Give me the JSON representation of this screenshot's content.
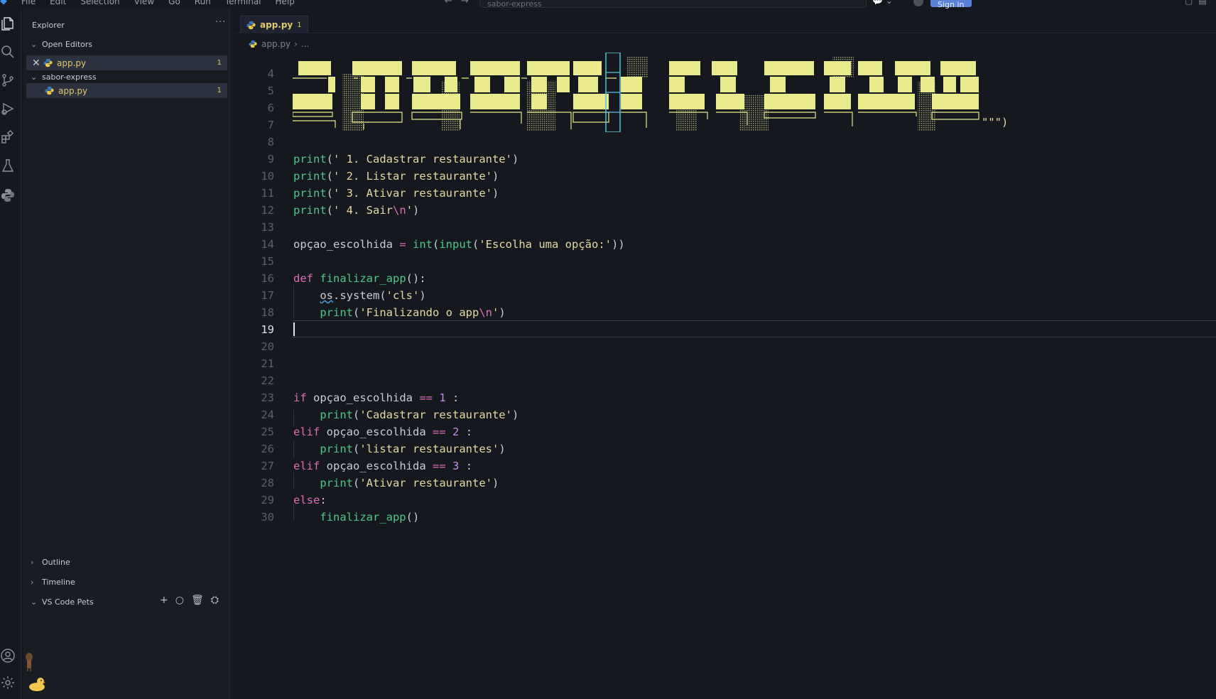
{
  "menubar": {
    "items": [
      "File",
      "Edit",
      "Selection",
      "View",
      "Go",
      "Run",
      "Terminal",
      "Help"
    ],
    "search_text": "sabor-express",
    "signin_label": "Sign in"
  },
  "activity_icons": [
    "explorer-icon",
    "search-icon",
    "source-control-icon",
    "run-debug-icon",
    "extensions-icon",
    "testing-icon",
    "python-icon",
    "account-icon",
    "settings-gear-icon"
  ],
  "sidebar": {
    "title": "Explorer",
    "more": "···",
    "open_editors_label": "Open Editors",
    "open_file": {
      "name": "app.py",
      "badge": "1"
    },
    "folder_label": "sabor-express",
    "folder_file": {
      "name": "app.py",
      "badge": "1"
    },
    "outline_label": "Outline",
    "timeline_label": "Timeline",
    "pets_label": "VS Code Pets"
  },
  "editor": {
    "tab": {
      "name": "app.py",
      "badge": "1"
    },
    "breadcrumb": {
      "file": "app.py",
      "more": "..."
    },
    "ascii_tail": "\"\"\")",
    "lines": {
      "l4": "4",
      "l5": "5",
      "l6": "6",
      "l7": "7",
      "l8": "8",
      "l9": "9",
      "l10": "10",
      "l11": "11",
      "l12": "12",
      "l13": "13",
      "l14": "14",
      "l15": "15",
      "l16": "16",
      "l17": "17",
      "l18": "18",
      "l19": "19",
      "l20": "20",
      "l21": "21",
      "l22": "22",
      "l23": "23",
      "l24": "24",
      "l25": "25",
      "l26": "26",
      "l27": "27",
      "l28": "28",
      "l29": "29",
      "l30": "30"
    },
    "code": {
      "print": "print",
      "s9": "' 1. Cadastrar restaurante'",
      "s10": "' 2. Listar restaurante'",
      "s11": "' 3. Ativar restaurante'",
      "s12a": "' 4. Sair",
      "nl": "\\n",
      "q": "'",
      "var": "opçao_escolhida",
      "eq": " = ",
      "int": "int",
      "input": "input",
      "s14": "'Escolha uma opção:'",
      "def": "def",
      "finalizar": "finalizar_app",
      "os": "os",
      "system": ".system",
      "s17": "'cls'",
      "s18a": "'Finalizando o app",
      "if": "if",
      "elif": "elif",
      "else": "else",
      "eqeq": "==",
      "n1": "1",
      "n2": "2",
      "n3": "3",
      "s24": "'Cadastrar restaurante'",
      "s26": "'listar restaurantes'",
      "s28": "'Ativar restaurante'"
    }
  },
  "colors": {
    "background": "#15181f",
    "sidebar": "#191c23",
    "keyword": "#e06cb8",
    "function": "#4ec98a",
    "string": "#e4d9a3",
    "number": "#c68cf0",
    "ascii_block": "#e8ea8c",
    "modified": "#e4c96a",
    "signin": "#5a7fd6"
  }
}
